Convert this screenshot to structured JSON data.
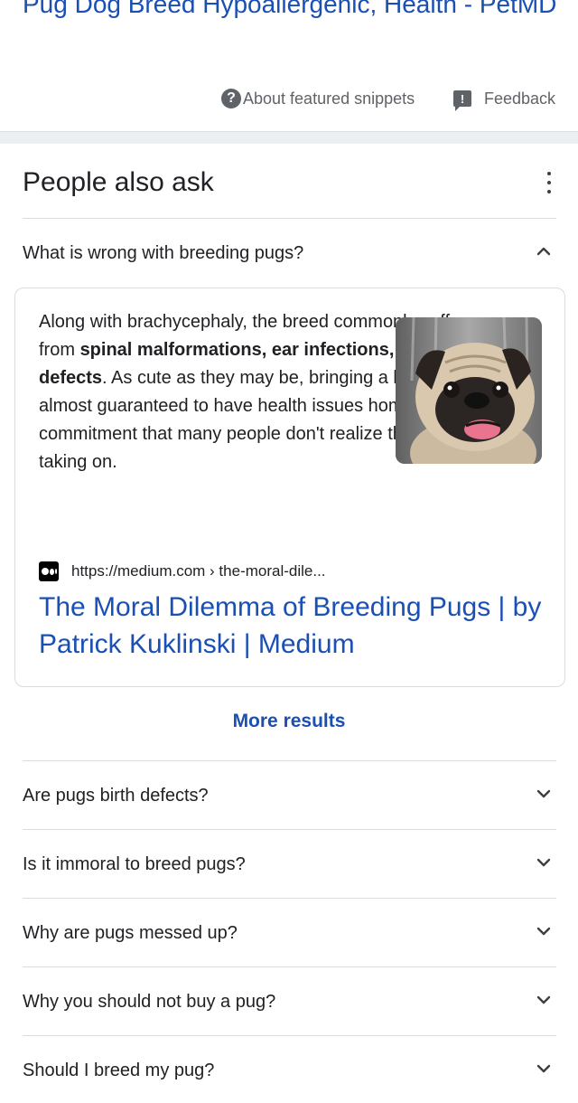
{
  "previous_result": {
    "title": "Pug Dog Breed Hypoallergenic, Health - PetMD",
    "about_label": "About featured snippets",
    "feedback_label": "Feedback"
  },
  "paa": {
    "header": "People also ask",
    "expanded_question": "What is wrong with breeding pugs?",
    "answer": {
      "text_1": "Along with brachycephaly, the breed commonly suffers from ",
      "bold": "spinal malformations, ear infections, and heart defects",
      "text_2": ". As cute as they may be, bringing a breed almost guaranteed to have health issues home is a big commitment that many people don't realize they are taking on.",
      "image_alt": "pug-photo",
      "source_url": "https://medium.com › the-moral-dile...",
      "link_title": "The Moral Dilemma of Breeding Pugs | by Patrick Kuklinski | Medium"
    },
    "more_results": "More results",
    "questions": [
      "Are pugs birth defects?",
      "Is it immoral to breed pugs?",
      "Why are pugs messed up?",
      "Why you should not buy a pug?",
      "Should I breed my pug?"
    ]
  },
  "colors": {
    "link": "#1a4fb4",
    "text": "#202124",
    "muted": "#5f6368",
    "border": "#dadce0"
  },
  "icons": [
    "help-circle-icon",
    "feedback-icon",
    "more-vert-icon",
    "chevron-up-icon",
    "chevron-down-icon",
    "medium-logo-icon"
  ]
}
